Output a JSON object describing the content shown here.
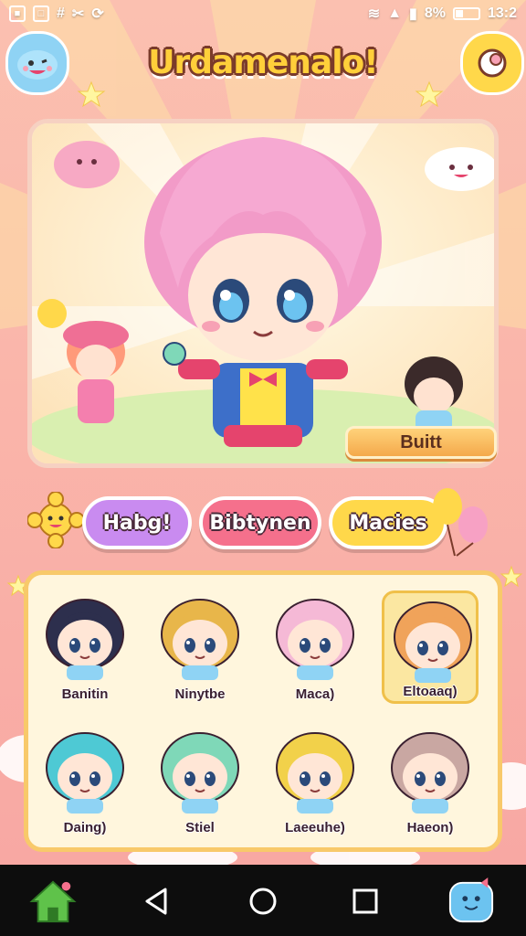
{
  "status_bar": {
    "battery": "8%",
    "time": "13:2"
  },
  "header": {
    "title": "Urdamenalo!"
  },
  "hero": {
    "action_button": "Buitt"
  },
  "tabs": [
    {
      "label": "Habg!",
      "color": "#c98bf0"
    },
    {
      "label": "Bibtynen",
      "color": "#f5708c"
    },
    {
      "label": "Macies",
      "color": "#ffd84a"
    }
  ],
  "roster": {
    "characters": [
      {
        "name": "Banitin",
        "hair": "#2d2f4d",
        "selected": false
      },
      {
        "name": "Ninytbe",
        "hair": "#e8b64a",
        "selected": false
      },
      {
        "name": "Maca)",
        "hair": "#f5b9d6",
        "selected": false
      },
      {
        "name": "Eltoaaq)",
        "hair": "#f0a35a",
        "selected": true
      },
      {
        "name": "Daing)",
        "hair": "#4ec9d4",
        "selected": false
      },
      {
        "name": "Stiel",
        "hair": "#7fd8b8",
        "selected": false
      },
      {
        "name": "Laeeuhe)",
        "hair": "#f2d14a",
        "selected": false
      },
      {
        "name": "Haeon)",
        "hair": "#c9a7a2",
        "selected": false
      }
    ]
  },
  "colors": {
    "accent": "#ffcf3a",
    "panel_border": "#f8c96a",
    "bg": "#f7a9a1"
  }
}
